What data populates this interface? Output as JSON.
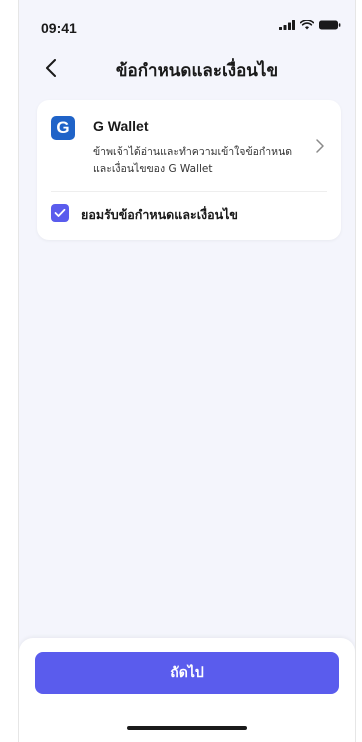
{
  "status_bar": {
    "time": "09:41",
    "icons": [
      "signal-icon",
      "wifi-icon",
      "battery-icon"
    ]
  },
  "nav": {
    "back_icon": "chevron-left-icon",
    "title": "ข้อกำหนดและเงื่อนไข"
  },
  "terms": {
    "provider": {
      "logo_letter": "G",
      "name": "G Wallet",
      "description": "ข้าพเจ้าได้อ่านและทำความเข้าใจข้อกำหนดและเงื่อนไขของ G Wallet",
      "chevron_icon": "chevron-right-icon"
    },
    "accept": {
      "checked": true,
      "label": "ยอมรับข้อกำหนดและเงื่อนไข"
    }
  },
  "footer": {
    "next_label": "ถัดไป"
  },
  "colors": {
    "accent": "#5a5ced",
    "logo": "#1f63c8",
    "background": "#f4f5fc"
  }
}
